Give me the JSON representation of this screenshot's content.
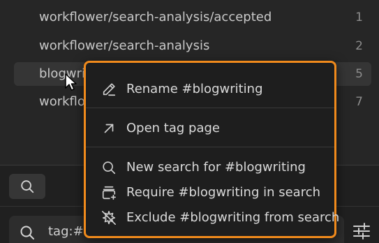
{
  "tags": [
    {
      "name": "workflower/search-analysis/accepted",
      "count": "1"
    },
    {
      "name": "workflower/search-analysis",
      "count": "2"
    },
    {
      "name": "blogwriting",
      "visible_name": "blogwri",
      "count": "5",
      "selected": true
    },
    {
      "name": "workflower",
      "visible_name": "workflo",
      "count": "7"
    }
  ],
  "search": {
    "value": "tag:#b",
    "toggle_icon": "search-icon",
    "filter_icon": "sliders-icon"
  },
  "context_menu": {
    "items": [
      {
        "label": "Rename #blogwriting",
        "icon": "pencil-icon"
      },
      {
        "label": "Open tag page",
        "icon": "arrow-up-right-icon"
      },
      {
        "label": "New search for #blogwriting",
        "icon": "search-icon"
      },
      {
        "label": "Require #blogwriting in search",
        "icon": "require-in-search-icon"
      },
      {
        "label": "Exclude #blogwriting from search",
        "icon": "exclude-from-search-icon"
      }
    ]
  },
  "colors": {
    "accent_border": "#f08a1c",
    "background": "#262626",
    "menu_background": "#1e1e1e",
    "text": "#dadada",
    "muted_text": "#8c8c8c"
  }
}
